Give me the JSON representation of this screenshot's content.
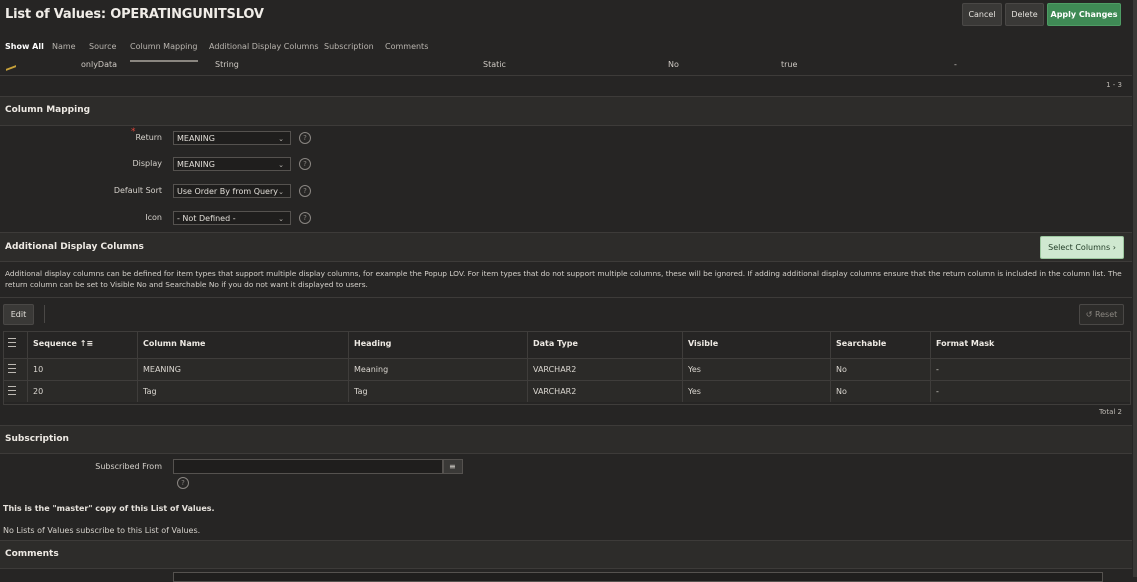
{
  "page": {
    "title": "List of Values: OPERATINGUNITSLOV",
    "buttons": {
      "cancel": "Cancel",
      "delete": "Delete",
      "apply": "Apply Changes"
    }
  },
  "tabs": [
    "Show All",
    "Name",
    "Source",
    "Column Mapping",
    "Additional Display Columns",
    "Subscription",
    "Comments"
  ],
  "top_row": {
    "name": "onlyData",
    "type": "String",
    "source": "Static",
    "flag": "No",
    "value": "true",
    "dash": "-",
    "pagination": "1 - 3"
  },
  "column_mapping": {
    "title": "Column Mapping",
    "fields": [
      {
        "label": "Return",
        "value": "MEANING",
        "required": "*"
      },
      {
        "label": "Display",
        "value": "MEANING"
      },
      {
        "label": "Default Sort",
        "value": "Use Order By from Query"
      },
      {
        "label": "Icon",
        "value": "- Not Defined -"
      }
    ],
    "help": "?"
  },
  "additional_display_columns": {
    "title": "Additional Display Columns",
    "select_button": "Select Columns",
    "description": "Additional display columns can be defined for item types that support multiple display columns, for example the Popup LOV. For item types that do not support multiple columns, these will be ignored. If adding additional display columns ensure that the return column is included in the column list. The return column can be set to Visible No and Searchable No if you do not want it displayed to users.",
    "edit_button": "Edit",
    "reset_button": "Reset",
    "headers": [
      "Sequence",
      "Column Name",
      "Heading",
      "Data Type",
      "Visible",
      "Searchable",
      "Format Mask"
    ],
    "rows": [
      [
        "10",
        "MEANING",
        "Meaning",
        "VARCHAR2",
        "Yes",
        "No",
        "-"
      ],
      [
        "20",
        "Tag",
        "Tag",
        "VARCHAR2",
        "Yes",
        "No",
        "-"
      ]
    ],
    "total": "Total 2"
  },
  "subscription": {
    "title": "Subscription",
    "subscribed_from_label": "Subscribed From",
    "subscribed_from_value": "",
    "master_note": "This is the \"master\" copy of this List of Values.",
    "no_subscribers": "No Lists of Values subscribe to this List of Values."
  },
  "comments": {
    "title": "Comments"
  },
  "colors": {
    "background": "#262524",
    "primary": "#3f8a55",
    "required": "#e0453a"
  }
}
